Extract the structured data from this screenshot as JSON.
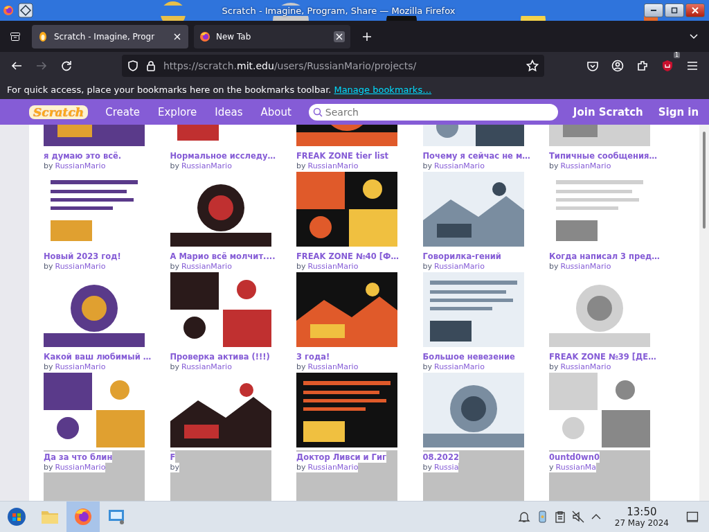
{
  "window": {
    "title": "Scratch - Imagine, Program, Share — Mozilla Firefox"
  },
  "tabs": [
    {
      "label": "Scratch - Imagine, Progr",
      "selected": true,
      "kind": "scratch"
    },
    {
      "label": "New Tab",
      "selected": false,
      "kind": "firefox"
    }
  ],
  "address_bar": {
    "url": "https://scratch.**mit.edu**/users/RussianMario/projects/"
  },
  "extension_badge": "1",
  "bookmarks_bar": {
    "message": "For quick access, place your bookmarks here on the bookmarks toolbar.",
    "link": "Manage bookmarks…"
  },
  "site_header": {
    "logo": "Scratch",
    "nav": [
      "Create",
      "Explore",
      "Ideas",
      "About"
    ],
    "search": {
      "placeholder": "Search"
    },
    "actions": [
      "Join Scratch",
      "Sign in"
    ]
  },
  "projects": [
    {
      "kind": "project",
      "title": "я думаю это всё.",
      "by": "by",
      "author": "RussianMario"
    },
    {
      "kind": "project",
      "title": "Нормальное исследу…",
      "by": "by",
      "author": "RussianMario"
    },
    {
      "kind": "project",
      "title": "FREAK ZONE tier list",
      "by": "by",
      "author": "RussianMario"
    },
    {
      "kind": "project",
      "title": "Почему я сейчас не м…",
      "by": "by",
      "author": "RussianMario"
    },
    {
      "kind": "project",
      "title": "Типичные сообщения…",
      "by": "by",
      "author": "RussianMario"
    },
    {
      "kind": "project",
      "title": "Новый 2023 год!",
      "by": "by",
      "author": "RussianMario"
    },
    {
      "kind": "project",
      "title": "А Марио всё молчит....",
      "by": "by",
      "author": "RussianMario"
    },
    {
      "kind": "project",
      "title": "FREAK ZONE №40 [Ф…",
      "by": "by",
      "author": "RussianMario"
    },
    {
      "kind": "project",
      "title": "Говорилка-гений",
      "by": "by",
      "author": "RussianMario"
    },
    {
      "kind": "project",
      "title": "Когда написал 3 пред…",
      "by": "by",
      "author": "RussianMario"
    },
    {
      "kind": "project",
      "title": "Какой ваш любимый …",
      "by": "by",
      "author": "RussianMario"
    },
    {
      "kind": "project",
      "title": "Проверка актива (!!!)",
      "by": "by",
      "author": "RussianMario"
    },
    {
      "kind": "project",
      "title": "3 года!",
      "by": "by",
      "author": "RussianMario"
    },
    {
      "kind": "project",
      "title": "Большое невезение",
      "by": "by",
      "author": "RussianMario"
    },
    {
      "kind": "project",
      "title": "FREAK ZONE №39 [ДЕ…",
      "by": "by",
      "author": "RussianMario"
    },
    {
      "kind": "project",
      "title": "Да за что блин",
      "by": "by",
      "author": "RussianMario",
      "covered": true
    },
    {
      "kind": "project",
      "title": "F",
      "by": "by",
      "covered": true
    },
    {
      "kind": "project",
      "title": "Доктор Ливси и Гиг",
      "by": "by",
      "author": "RussianMario",
      "covered": true
    },
    {
      "kind": "project",
      "title": "08.2022",
      "by": "by",
      "author": "Russia",
      "covered": true
    },
    {
      "kind": "project",
      "title": "0untd0wn0",
      "by": "y",
      "author": "RussianMa",
      "covered": true
    },
    {
      "kind": "loading"
    },
    {
      "kind": "loading"
    },
    {
      "kind": "loading"
    },
    {
      "kind": "loading"
    },
    {
      "kind": "loading"
    }
  ],
  "taskbar": {
    "apps": [
      {
        "kind": "start",
        "selected": false
      },
      {
        "kind": "files",
        "selected": false
      },
      {
        "kind": "firefox",
        "selected": true
      },
      {
        "kind": "monitor",
        "selected": false
      }
    ],
    "clock": {
      "time": "13:50",
      "date": "27 May 2024"
    }
  }
}
